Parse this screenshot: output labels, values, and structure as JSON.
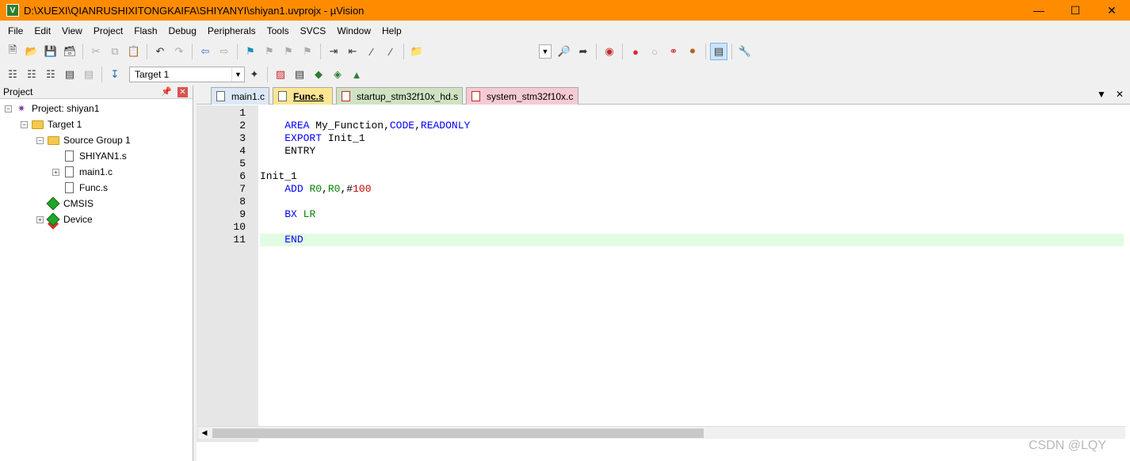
{
  "window": {
    "title": "D:\\XUEXI\\QIANRUSHIXITONGKAIFA\\SHIYANYI\\shiyan1.uvprojx - µVision",
    "app_icon": "keil-uvision-icon"
  },
  "menu": [
    "File",
    "Edit",
    "View",
    "Project",
    "Flash",
    "Debug",
    "Peripherals",
    "Tools",
    "SVCS",
    "Window",
    "Help"
  ],
  "build_toolbar": {
    "target": "Target 1"
  },
  "project_panel": {
    "title": "Project",
    "tree": {
      "project": "Project: shiyan1",
      "target": "Target 1",
      "group": "Source Group 1",
      "files": [
        "SHIYAN1.s",
        "main1.c",
        "Func.s"
      ],
      "cmsis": "CMSIS",
      "device": "Device"
    }
  },
  "editor": {
    "tabs": [
      "main1.c",
      "Func.s",
      "startup_stm32f10x_hd.s",
      "system_stm32f10x.c"
    ],
    "line_numbers": [
      "1",
      "2",
      "3",
      "4",
      "5",
      "6",
      "7",
      "8",
      "9",
      "10",
      "11"
    ],
    "code": {
      "l2": {
        "kw": "AREA",
        "name": "My_Function,",
        "kw2": "CODE",
        "comma": ",",
        "kw3": "READONLY"
      },
      "l3": {
        "kw": "EXPORT",
        "name": "Init_1"
      },
      "l4": {
        "text": "ENTRY"
      },
      "l6": {
        "text": "Init_1"
      },
      "l7": {
        "kw": "ADD",
        "r1": "R0",
        "c1": ",",
        "r2": "R0",
        "c2": ",",
        "hash": "#",
        "num": "100"
      },
      "l9": {
        "kw": "BX",
        "reg": "LR"
      },
      "l11": {
        "kw": "END"
      }
    }
  },
  "watermark": "CSDN @LQY",
  "colors": {
    "title_bar": "#ff8c00",
    "keyword": "#0000ff",
    "register": "#008000",
    "number": "#c00000",
    "current_line": "#e3fbe3"
  }
}
